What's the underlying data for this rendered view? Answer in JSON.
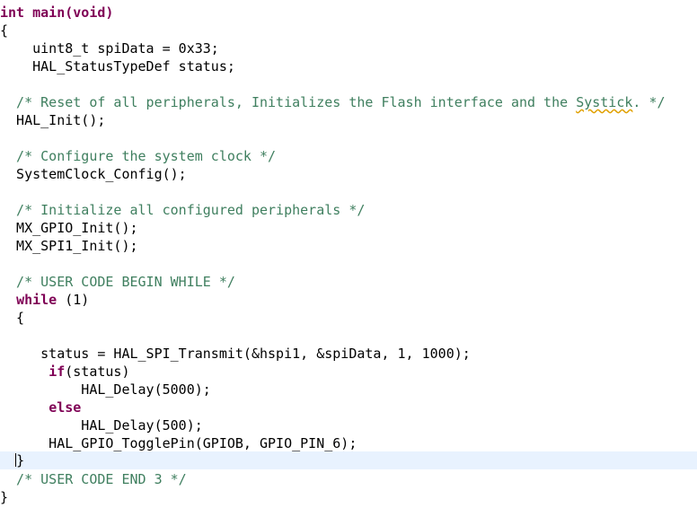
{
  "editor": {
    "lines": {
      "l1_kw": "int",
      "l1_fn": " main(",
      "l1_kw2": "void",
      "l1_end": ")",
      "l2": "{",
      "l3": "    uint8_t spiData = 0x33;",
      "l4": "    HAL_StatusTypeDef status;",
      "l6_a": "  /* Reset of all peripherals, Initializes the Flash interface and the ",
      "l6_spell": "Systick",
      "l6_b": ". */",
      "l7": "  HAL_Init();",
      "l9": "  /* Configure the system clock */",
      "l10": "  SystemClock_Config();",
      "l12": "  /* Initialize all configured peripherals */",
      "l13": "  MX_GPIO_Init();",
      "l14": "  MX_SPI1_Init();",
      "l16": "  /* USER CODE BEGIN WHILE */",
      "l17_indent": "  ",
      "l17_kw": "while",
      "l17_rest": " (1)",
      "l18": "  {",
      "l20": "     status = HAL_SPI_Transmit(&hspi1, &spiData, 1, 1000);",
      "l21_indent": "      ",
      "l21_kw": "if",
      "l21_rest": "(status)",
      "l22": "          HAL_Delay(5000);",
      "l23_indent": "      ",
      "l23_kw": "else",
      "l24": "          HAL_Delay(500);",
      "l25": "      HAL_GPIO_TogglePin(GPIOB, GPIO_PIN_6);",
      "l26_indent": "  ",
      "l26_brace": "}",
      "l27": "  /* USER CODE END 3 */",
      "l28": "}"
    },
    "colors": {
      "keyword": "#7f0055",
      "comment": "#3f7f5f",
      "current_line": "#e8f2fe"
    }
  }
}
